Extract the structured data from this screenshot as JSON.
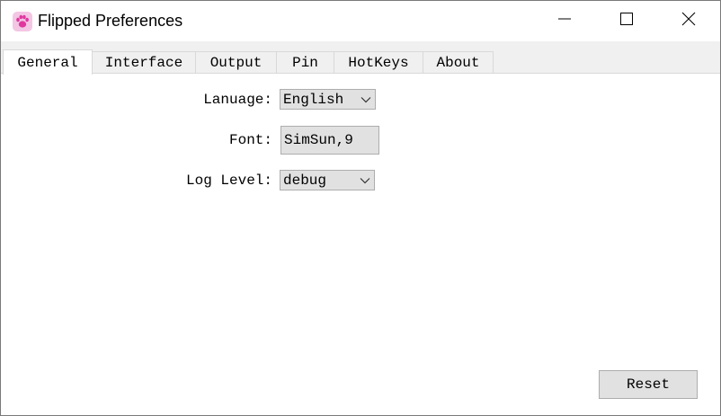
{
  "window": {
    "title": "Flipped Preferences",
    "app_icon": "paw-icon",
    "controls": {
      "minimize_icon": "minimize-icon",
      "maximize_icon": "maximize-icon",
      "close_icon": "close-icon"
    }
  },
  "tabs": [
    {
      "label": "General",
      "active": true
    },
    {
      "label": "Interface",
      "active": false
    },
    {
      "label": "Output",
      "active": false
    },
    {
      "label": "Pin",
      "active": false
    },
    {
      "label": "HotKeys",
      "active": false
    },
    {
      "label": "About",
      "active": false
    }
  ],
  "general": {
    "language": {
      "label": "Lanuage:",
      "value": "English"
    },
    "font": {
      "label": "Font:",
      "value": "SimSun,9"
    },
    "log_level": {
      "label": "Log Level:",
      "value": "debug"
    },
    "reset_label": "Reset"
  },
  "colors": {
    "app_icon_bg": "#f3c6e4",
    "app_icon_paw": "#e0379f",
    "tab_bar_bg": "#f0f0f0",
    "button_bg": "#e1e1e1",
    "border": "#adadad"
  }
}
